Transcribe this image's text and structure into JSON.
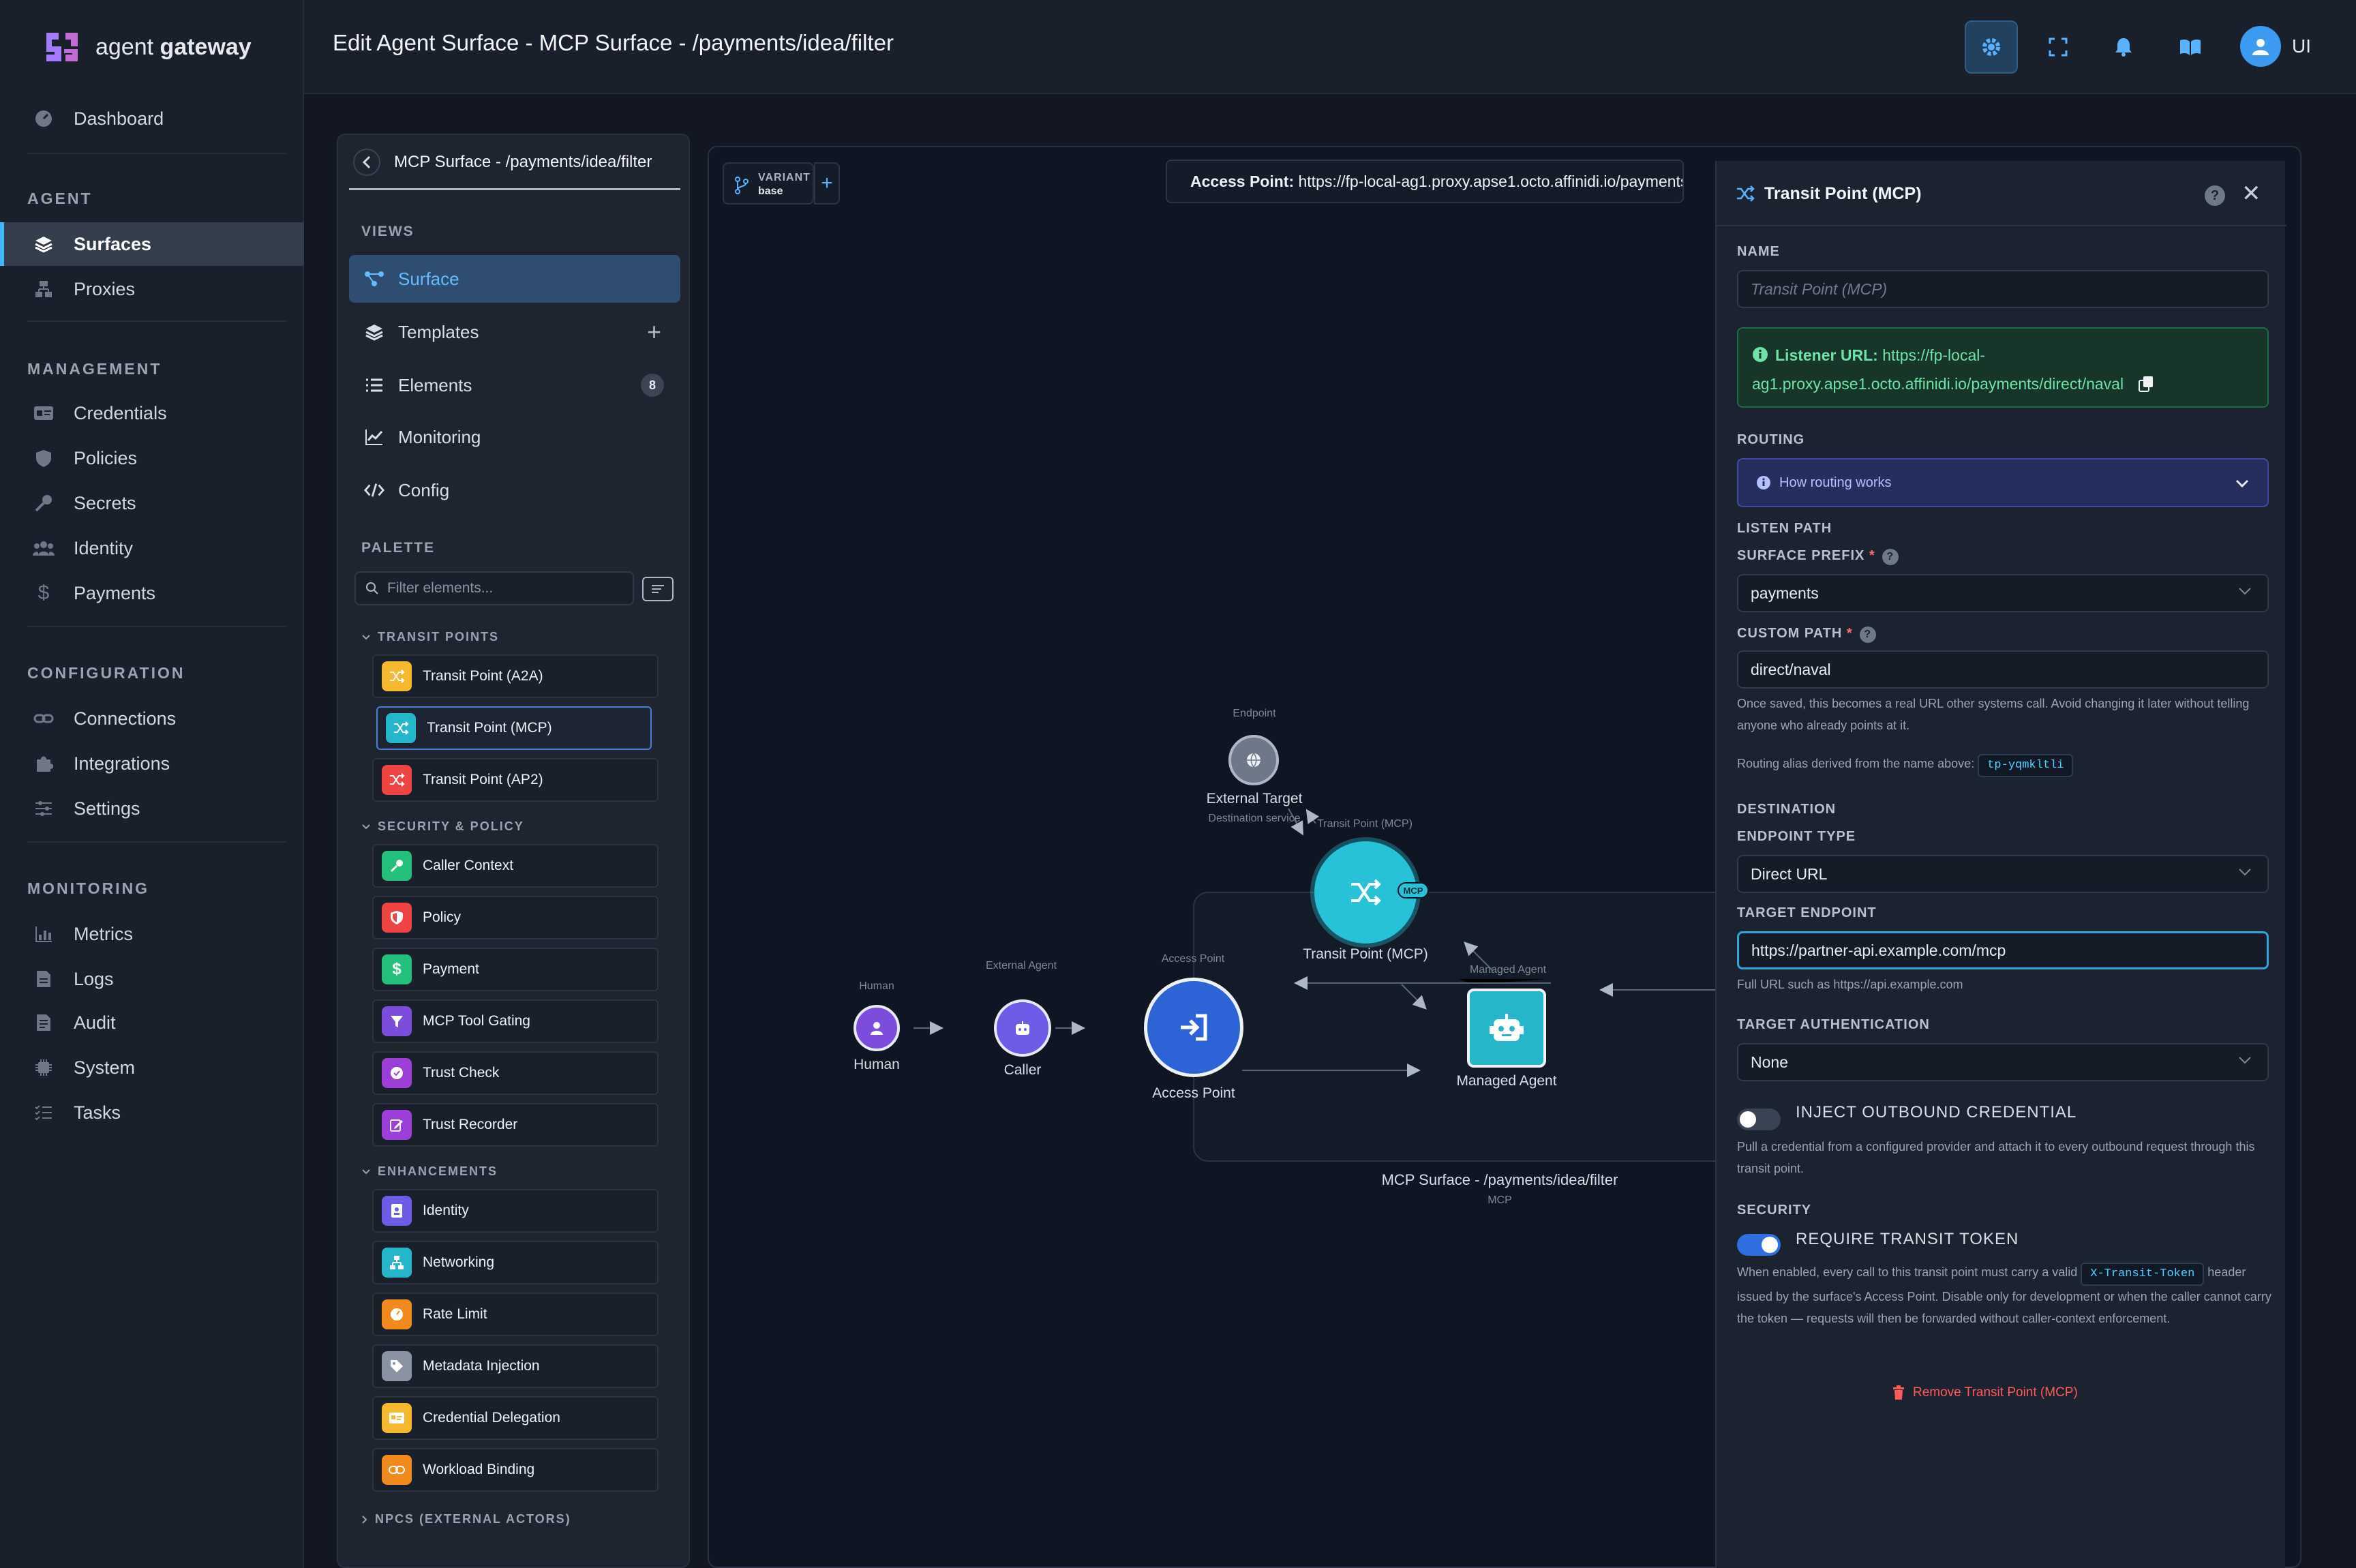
{
  "app": {
    "name_light": "agent",
    "name_bold": "gateway",
    "brand_color": "#a47bff"
  },
  "sidebar": {
    "dashboard": "Dashboard",
    "sections": [
      {
        "title": "AGENT",
        "items": [
          "Surfaces",
          "Proxies"
        ]
      },
      {
        "title": "MANAGEMENT",
        "items": [
          "Credentials",
          "Policies",
          "Secrets",
          "Identity",
          "Payments"
        ]
      },
      {
        "title": "CONFIGURATION",
        "items": [
          "Connections",
          "Integrations",
          "Settings"
        ]
      },
      {
        "title": "MONITORING",
        "items": [
          "Metrics",
          "Logs",
          "Audit",
          "System",
          "Tasks"
        ]
      }
    ],
    "active_item": "Surfaces"
  },
  "topbar": {
    "title": "Edit Agent Surface - MCP Surface - /payments/idea/filter",
    "icons": [
      "gear-icon",
      "fullscreen-icon",
      "bell-icon",
      "book-icon"
    ],
    "user_label": "UI"
  },
  "panel": {
    "title": "MCP Surface - /payments/idea/filter",
    "views_title": "VIEWS",
    "views": [
      {
        "label": "Surface",
        "icon": "graph-icon"
      },
      {
        "label": "Templates",
        "icon": "layers-icon"
      },
      {
        "label": "Elements",
        "icon": "list-icon",
        "count": "8"
      },
      {
        "label": "Monitoring",
        "icon": "chart-icon"
      },
      {
        "label": "Config",
        "icon": "code-icon"
      }
    ],
    "palette_title": "PALETTE",
    "filter_placeholder": "Filter elements...",
    "groups": [
      {
        "title": "TRANSIT POINTS",
        "items": [
          {
            "label": "Transit Point (A2A)",
            "color": "#f5b82e",
            "selected": false
          },
          {
            "label": "Transit Point (MCP)",
            "color": "#26b6c9",
            "selected": true
          },
          {
            "label": "Transit Point (AP2)",
            "color": "#ef4444",
            "selected": false
          }
        ]
      },
      {
        "title": "SECURITY & POLICY",
        "items": [
          {
            "label": "Caller Context",
            "color": "#22c07a"
          },
          {
            "label": "Policy",
            "color": "#ef4444"
          },
          {
            "label": "Payment",
            "color": "#22c07a"
          },
          {
            "label": "MCP Tool Gating",
            "color": "#7c4ddb"
          },
          {
            "label": "Trust Check",
            "color": "#9b3fd8"
          },
          {
            "label": "Trust Recorder",
            "color": "#9b3fd8"
          }
        ]
      },
      {
        "title": "ENHANCEMENTS",
        "items": [
          {
            "label": "Identity",
            "color": "#6f5ce6"
          },
          {
            "label": "Networking",
            "color": "#26b6c9"
          },
          {
            "label": "Rate Limit",
            "color": "#f08a1c"
          },
          {
            "label": "Metadata Injection",
            "color": "#8a93a3"
          },
          {
            "label": "Credential Delegation",
            "color": "#f5b82e"
          },
          {
            "label": "Workload Binding",
            "color": "#f08a1c"
          }
        ]
      }
    ],
    "collapsed_group": "NPCS (EXTERNAL ACTORS)"
  },
  "canvas": {
    "variant_label": "VARIANT",
    "variant_value": "base",
    "access_point_label": "Access Point:",
    "access_point_url": "https://fp-local-ag1.proxy.apse1.octo.affinidi.io/payments",
    "nodes": {
      "endpoint_caption": "Endpoint",
      "external_target": "External Target",
      "external_target_sub": "Destination service",
      "transit_caption": "Transit Point (MCP)",
      "transit_label": "Transit Point (MCP)",
      "mcp_chip": "MCP",
      "human_caption": "Human",
      "human_label": "Human",
      "caller_caption": "External Agent",
      "caller_label": "Caller",
      "access_caption": "Access Point",
      "access_label": "Access Point",
      "managed_caption": "Managed Agent",
      "managed_label": "Managed Agent"
    },
    "group_label": "MCP Surface - /payments/idea/filter",
    "group_sub": "MCP"
  },
  "details": {
    "title": "Transit Point (MCP)",
    "name_label": "NAME",
    "name_placeholder": "Transit Point (MCP)",
    "listener_label": "Listener URL:",
    "listener_url_1": "https://fp-local-",
    "listener_url_2": "ag1.proxy.apse1.octo.affinidi.io/payments/direct/naval",
    "routing_label": "ROUTING",
    "routing_help": "How routing works",
    "listen_path_label": "LISTEN PATH",
    "surface_prefix_label": "SURFACE PREFIX",
    "surface_prefix_value": "payments",
    "custom_path_label": "CUSTOM PATH",
    "custom_path_value": "direct/naval",
    "custom_path_hint": "Once saved, this becomes a real URL other systems call. Avoid changing it later without telling anyone who already points at it.",
    "alias_hint": "Routing alias derived from the name above:",
    "alias_value": "tp-yqmkltli",
    "destination_label": "DESTINATION",
    "endpoint_type_label": "ENDPOINT TYPE",
    "endpoint_type_value": "Direct URL",
    "target_endpoint_label": "TARGET ENDPOINT",
    "target_endpoint_value": "https://partner-api.example.com/mcp",
    "target_endpoint_hint": "Full URL such as https://api.example.com",
    "target_auth_label": "TARGET AUTHENTICATION",
    "target_auth_value": "None",
    "inject_label": "INJECT OUTBOUND CREDENTIAL",
    "inject_enabled": false,
    "inject_hint": "Pull a credential from a configured provider and attach it to every outbound request through this transit point.",
    "security_label": "SECURITY",
    "require_label": "REQUIRE TRANSIT TOKEN",
    "require_enabled": true,
    "require_hint_1": "When enabled, every call to this transit point must carry a valid",
    "require_token": "X-Transit-Token",
    "require_hint_2": "header issued by the surface's Access Point. Disable only for development or when the caller cannot carry the token — requests will then be forwarded without caller-context enforcement.",
    "remove_label": "Remove Transit Point (MCP)"
  }
}
